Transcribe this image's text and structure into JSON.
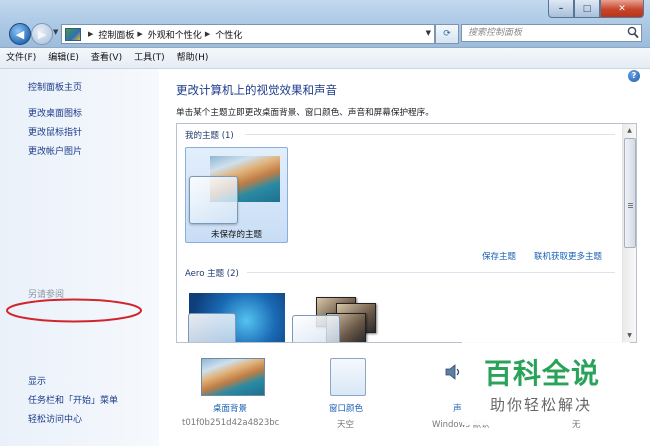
{
  "window": {
    "minimize": "–",
    "maximize": "□",
    "close": "✕"
  },
  "address": {
    "crumbs": [
      "控制面板",
      "外观和个性化",
      "个性化"
    ]
  },
  "search": {
    "placeholder": "搜索控制面板"
  },
  "menu": [
    "文件(F)",
    "编辑(E)",
    "查看(V)",
    "工具(T)",
    "帮助(H)"
  ],
  "sidebar": {
    "home": "控制面板主页",
    "links": [
      "更改桌面图标",
      "更改鼠标指针",
      "更改帐户图片"
    ],
    "see_also": "另请参阅",
    "bottom_links": [
      "显示",
      "任务栏和「开始」菜单",
      "轻松访问中心"
    ]
  },
  "main": {
    "title": "更改计算机上的视觉效果和声音",
    "description": "单击某个主题立即更改桌面背景、窗口颜色、声音和屏幕保护程序。",
    "my_themes_label": "我的主题 (1)",
    "unsaved_theme": "未保存的主题",
    "save_theme": "保存主题",
    "get_more": "联机获取更多主题",
    "aero_label": "Aero 主题 (2)",
    "bottom": {
      "background_label": "桌面背景",
      "background_value": "t01f0b251d42a4823bc",
      "color_label": "窗口颜色",
      "color_value": "天空",
      "sound_label": "声",
      "sound_value": "Windows 默认",
      "saver_value": "无"
    }
  },
  "watermark": {
    "title": "百科全说",
    "subtitle": "助你轻松解决"
  },
  "colors": {
    "link": "#1a5fb4",
    "title": "#1d3b8b",
    "annotation": "#d0262b",
    "watermark": "#2aa35a"
  }
}
